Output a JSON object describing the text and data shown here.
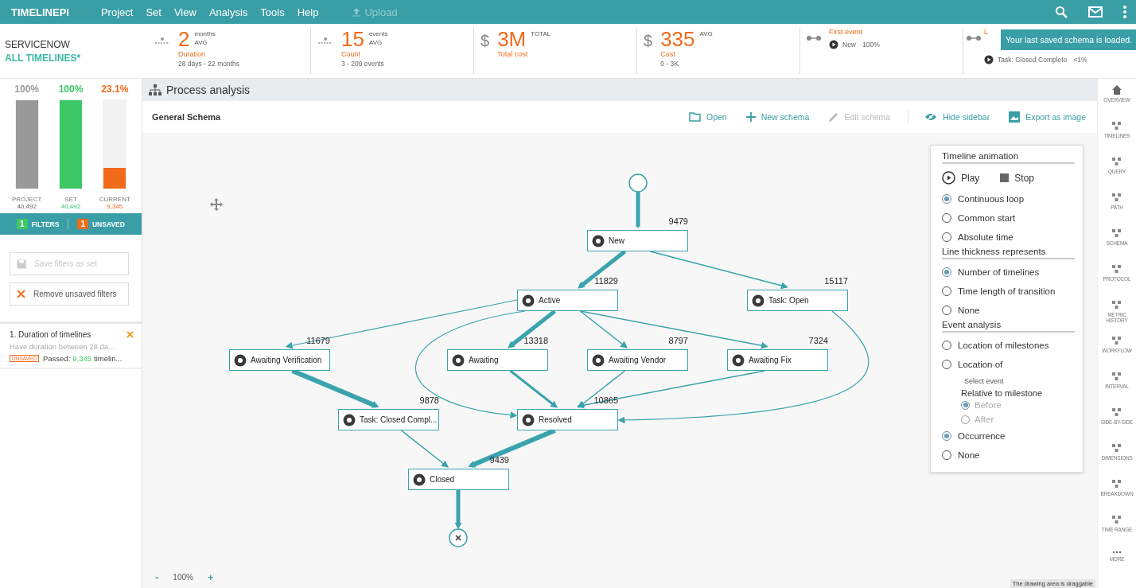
{
  "top_bar": {
    "logo": "TIMELINEPI",
    "menu": [
      "Project",
      "Set",
      "View",
      "Analysis",
      "Tools",
      "Help"
    ],
    "upload": {
      "label": "Upload",
      "disabled": true
    }
  },
  "toast": "Your last saved schema is loaded.",
  "project": {
    "name": "SERVICENOW",
    "set": "ALL TIMELINES*"
  },
  "kpis": [
    {
      "kind": "metric",
      "value": "2",
      "unit": "months",
      "sub": "AVG",
      "label": "Duration",
      "range": "28 days - 22 months"
    },
    {
      "kind": "metric",
      "value": "15",
      "unit": "events",
      "sub": "AVG",
      "label": "Count",
      "range": "3 - 209 events"
    },
    {
      "kind": "metric",
      "prefix": "$",
      "value": "3M",
      "unit": "TOTAL",
      "label": "Total cost"
    },
    {
      "kind": "metric",
      "prefix": "$",
      "value": "335",
      "unit": "AVG",
      "label": "Cost",
      "range": "0 - 3K"
    },
    {
      "kind": "event",
      "label": "First event",
      "event": "New",
      "share": "100%"
    },
    {
      "kind": "event",
      "label": "L",
      "event": "Task: Closed Complete",
      "share": "<1%"
    }
  ],
  "coverage": [
    {
      "percent": "100%",
      "label": "PROJECT",
      "count": "40,492",
      "level": 1,
      "color": "#999999"
    },
    {
      "percent": "100%",
      "label": "SET",
      "count": "40,492",
      "level": 1,
      "color": "#3cc864"
    },
    {
      "percent": "23.1%",
      "label": "CURRENT",
      "count": "9,345",
      "level": 0.231,
      "color": "#f26a1b"
    }
  ],
  "filter_bar": {
    "filters_count": "1",
    "filters_label": "FILTERS",
    "unsaved_count": "1",
    "unsaved_label": "UNSAVED"
  },
  "filter_buttons": [
    {
      "label": "Save filters as set",
      "kind": "save",
      "disabled": true
    },
    {
      "label": "Remove unsaved filters",
      "kind": "remove",
      "disabled": false
    }
  ],
  "filters": [
    {
      "title": "1. Duration of timelines",
      "description": "Have duration between 28 da...",
      "badge": "UNSAVED",
      "passed_label": "Passed:",
      "passed_count": "9,345",
      "passed_suffix": "timelin..."
    }
  ],
  "panel": {
    "title": "Process analysis",
    "schema_name": "General Schema",
    "actions": [
      {
        "label": "Open",
        "kind": "folder",
        "disabled": false
      },
      {
        "label": "New schema",
        "kind": "plus",
        "disabled": false
      },
      {
        "label": "Edit schema",
        "kind": "pencil",
        "disabled": true
      },
      {
        "label": "Hide sidebar",
        "kind": "eye",
        "disabled": false
      },
      {
        "label": "Export as image",
        "kind": "image",
        "disabled": false
      }
    ]
  },
  "schema": {
    "nodes": [
      {
        "label": "New",
        "count": "9479"
      },
      {
        "label": "Active",
        "count": "11829"
      },
      {
        "label": "Task: Open",
        "count": "15117"
      },
      {
        "label": "Awaiting Verification",
        "count": "11679"
      },
      {
        "label": "Awaiting",
        "count": "13318"
      },
      {
        "label": "Awaiting Vendor",
        "count": "8797"
      },
      {
        "label": "Awaiting Fix",
        "count": "7324"
      },
      {
        "label": "Task: Closed Compl...",
        "count": "9878"
      },
      {
        "label": "Resolved",
        "count": "10865"
      },
      {
        "label": "Closed",
        "count": "9439"
      }
    ],
    "zoom": {
      "minus": "-",
      "value": "100%",
      "plus": "+"
    },
    "hint": "The drawing area is draggable"
  },
  "options": {
    "animation": {
      "title": "Timeline animation",
      "play": "Play",
      "stop": "Stop",
      "options": [
        {
          "label": "Continuous loop",
          "selected": true
        },
        {
          "label": "Common start",
          "selected": false
        },
        {
          "label": "Absolute time",
          "selected": false
        }
      ]
    },
    "thickness": {
      "title": "Line thickness represents",
      "options": [
        {
          "label": "Number of timelines",
          "selected": true
        },
        {
          "label": "Time length of transition",
          "selected": false
        },
        {
          "label": "None",
          "selected": false
        }
      ]
    },
    "event_analysis": {
      "title": "Event analysis",
      "options": [
        {
          "label": "Location of milestones",
          "selected": false
        },
        {
          "label": "Location of",
          "selected": false
        }
      ],
      "select_event": "Select event",
      "relative_title": "Relative to milestone",
      "relative_options": [
        {
          "label": "Before",
          "selected": true,
          "disabled": true
        },
        {
          "label": "After",
          "selected": false,
          "disabled": true
        }
      ],
      "more_options": [
        {
          "label": "Occurrence",
          "selected": true
        },
        {
          "label": "None",
          "selected": false
        }
      ]
    }
  },
  "nav": [
    {
      "label": "OVERVIEW"
    },
    {
      "label": "TIMELINES"
    },
    {
      "label": "QUERY"
    },
    {
      "label": "PATH"
    },
    {
      "label": "SCHEMA"
    },
    {
      "label": "PROTOCOL"
    },
    {
      "label": "METRIC HISTORY"
    },
    {
      "label": "WORKFLOW"
    },
    {
      "label": "INTERVAL"
    },
    {
      "label": "SIDE-BY-SIDE"
    },
    {
      "label": "DIMENSIONS"
    },
    {
      "label": "BREAKDOWN"
    },
    {
      "label": "TIME RANGE"
    },
    {
      "label": "MORE"
    }
  ]
}
